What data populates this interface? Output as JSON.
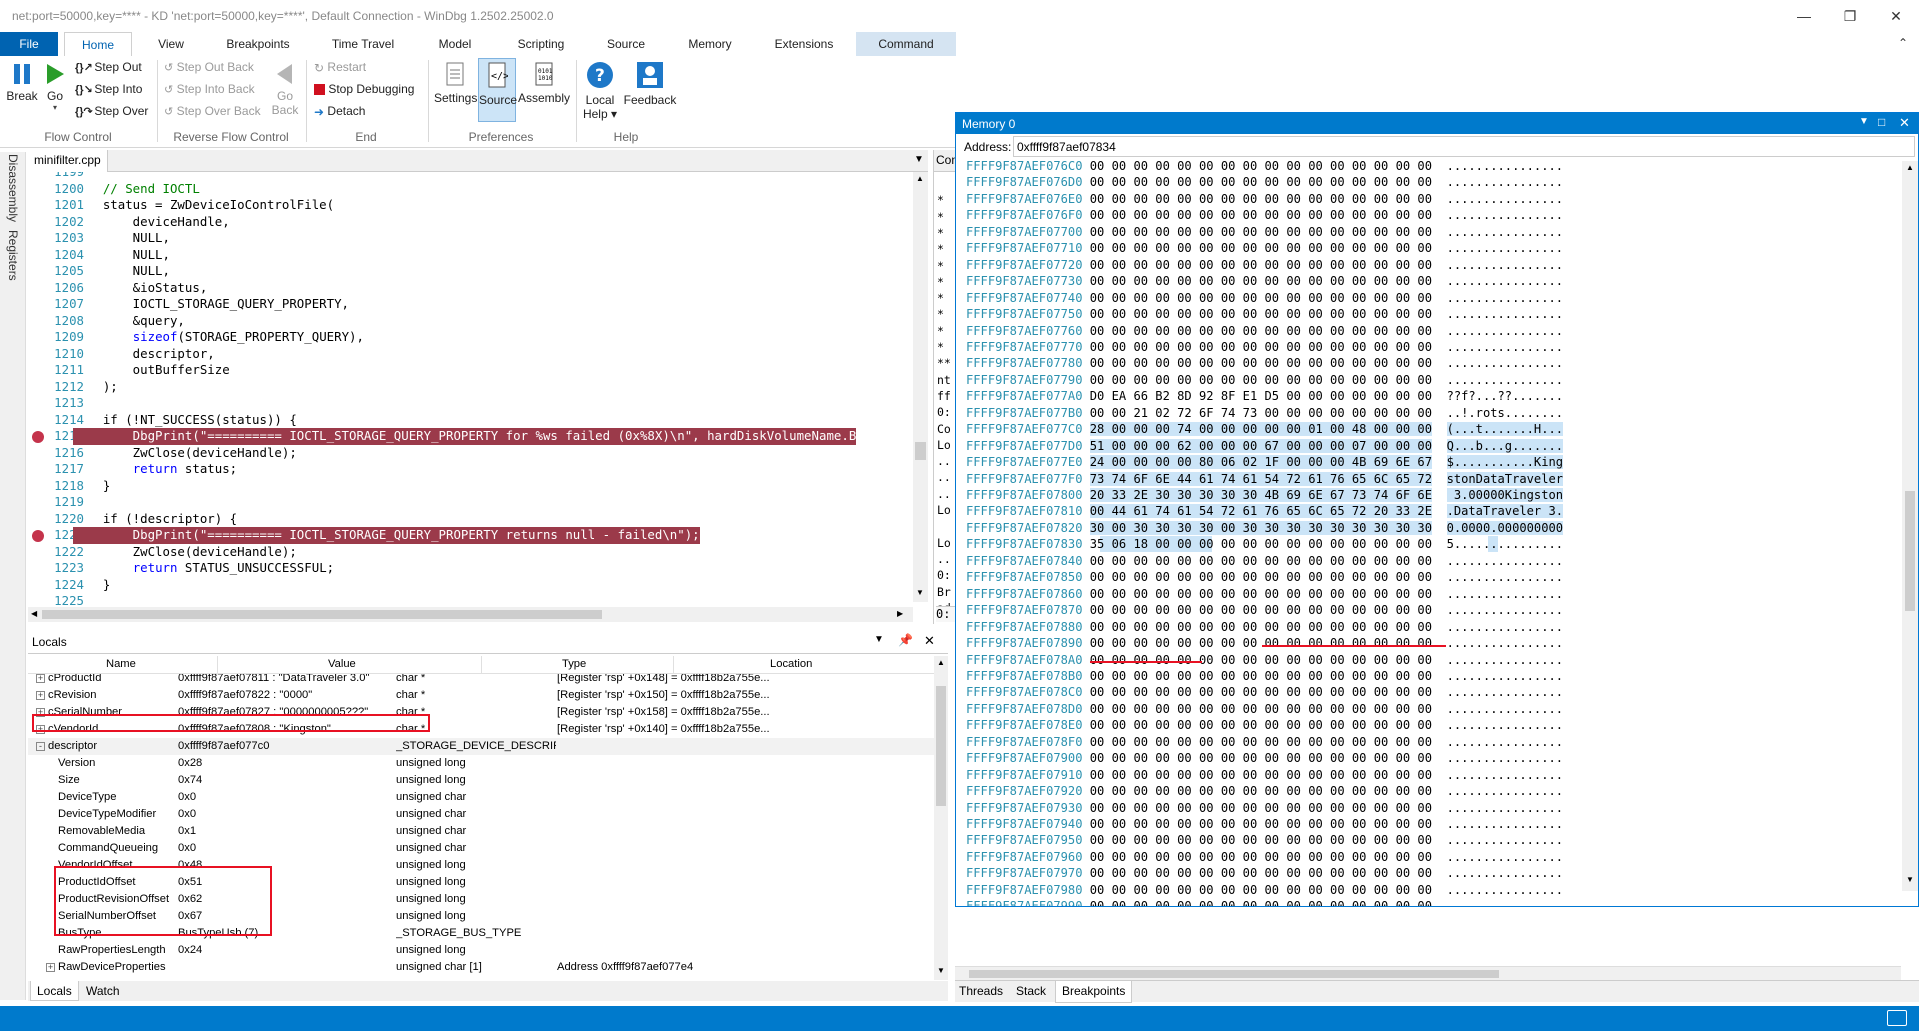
{
  "window": {
    "title": "net:port=50000,key=**** - KD 'net:port=50000,key=****', Default Connection  - WinDbg 1.2502.25002.0"
  },
  "menu_tabs": [
    "File",
    "Home",
    "View",
    "Breakpoints",
    "Time Travel",
    "Model",
    "Scripting",
    "Source",
    "Memory",
    "Extensions",
    "Command"
  ],
  "ribbon": {
    "break": "Break",
    "go": "Go",
    "step_out": "Step Out",
    "step_into": "Step Into",
    "step_over": "Step Over",
    "step_out_back": "Step Out Back",
    "step_into_back": "Step Into Back",
    "step_over_back": "Step Over Back",
    "go_back_1": "Go",
    "go_back_2": "Back",
    "restart": "Restart",
    "stop_debugging": "Stop Debugging",
    "detach": "Detach",
    "settings": "Settings",
    "source": "Source",
    "assembly": "Assembly",
    "local_help_1": "Local",
    "local_help_2": "Help ▾",
    "feedback": "Feedback",
    "groups": {
      "flow": "Flow Control",
      "reverse": "Reverse Flow Control",
      "end": "End",
      "prefs": "Preferences",
      "help": "Help"
    }
  },
  "side_tabs": {
    "disassembly": "Disassembly",
    "registers": "Registers"
  },
  "source": {
    "tab": "minifilter.cpp",
    "lines": [
      {
        "n": "1199",
        "code": "",
        "bp": false,
        "hl": false
      },
      {
        "n": "1200",
        "code": "    // Send IOCTL",
        "bp": false,
        "hl": false
      },
      {
        "n": "1201",
        "code": "    status = ZwDeviceIoControlFile(",
        "bp": false,
        "hl": false
      },
      {
        "n": "1202",
        "code": "        deviceHandle,",
        "bp": false,
        "hl": false
      },
      {
        "n": "1203",
        "code": "        NULL,",
        "bp": false,
        "hl": false
      },
      {
        "n": "1204",
        "code": "        NULL,",
        "bp": false,
        "hl": false
      },
      {
        "n": "1205",
        "code": "        NULL,",
        "bp": false,
        "hl": false
      },
      {
        "n": "1206",
        "code": "        &ioStatus,",
        "bp": false,
        "hl": false
      },
      {
        "n": "1207",
        "code": "        IOCTL_STORAGE_QUERY_PROPERTY,",
        "bp": false,
        "hl": false
      },
      {
        "n": "1208",
        "code": "        &query,",
        "bp": false,
        "hl": false
      },
      {
        "n": "1209",
        "code": "        sizeof(STORAGE_PROPERTY_QUERY),",
        "bp": false,
        "hl": false
      },
      {
        "n": "1210",
        "code": "        descriptor,",
        "bp": false,
        "hl": false
      },
      {
        "n": "1211",
        "code": "        outBufferSize",
        "bp": false,
        "hl": false
      },
      {
        "n": "1212",
        "code": "    );",
        "bp": false,
        "hl": false
      },
      {
        "n": "1213",
        "code": "",
        "bp": false,
        "hl": false
      },
      {
        "n": "1214",
        "code": "    if (!NT_SUCCESS(status)) {",
        "bp": false,
        "hl": false
      },
      {
        "n": "1215",
        "code": "        DbgPrint(\"========== IOCTL_STORAGE_QUERY_PROPERTY for %ws failed (0x%8X)\\n\", hardDiskVolumeName.B",
        "bp": true,
        "hl": true
      },
      {
        "n": "1216",
        "code": "        ZwClose(deviceHandle);",
        "bp": false,
        "hl": false
      },
      {
        "n": "1217",
        "code": "        return status;",
        "bp": false,
        "hl": false
      },
      {
        "n": "1218",
        "code": "    }",
        "bp": false,
        "hl": false
      },
      {
        "n": "1219",
        "code": "",
        "bp": false,
        "hl": false
      },
      {
        "n": "1220",
        "code": "    if (!descriptor) {",
        "bp": false,
        "hl": false
      },
      {
        "n": "1221",
        "code": "        DbgPrint(\"========== IOCTL_STORAGE_QUERY_PROPERTY returns null - failed\\n\");",
        "bp": true,
        "hl": true
      },
      {
        "n": "1222",
        "code": "        ZwClose(deviceHandle);",
        "bp": false,
        "hl": false
      },
      {
        "n": "1223",
        "code": "        return STATUS_UNSUCCESSFUL;",
        "bp": false,
        "hl": false
      },
      {
        "n": "1224",
        "code": "    }",
        "bp": false,
        "hl": false
      },
      {
        "n": "1225",
        "code": "",
        "bp": false,
        "hl": false
      }
    ]
  },
  "command_panel": {
    "tab": "Con",
    "lines": [
      "",
      "*",
      "*",
      "*",
      "*",
      "*",
      "*",
      "*",
      "*",
      "*",
      "*",
      "**",
      "nt",
      "ff",
      "0:",
      "Co",
      "Lo",
      "..",
      "..",
      "..",
      "Lo",
      "",
      "Lo",
      "..",
      "0:",
      "Br",
      "ad"
    ],
    "prompt": "0:"
  },
  "locals": {
    "title": "Locals",
    "columns": {
      "name": "Name",
      "value": "Value",
      "type": "Type",
      "location": "Location"
    },
    "rows": [
      {
        "expander": "+",
        "indent": 0,
        "name": "cProductId",
        "value": "0xffff9f87aef07811 : \"DataTraveler 3.0\"",
        "type": "char *",
        "location": "[Register 'rsp' +0x148] = 0xffff18b2a755e..."
      },
      {
        "expander": "+",
        "indent": 0,
        "name": "cRevision",
        "value": "0xffff9f87aef07822 : \"0000\"",
        "type": "char *",
        "location": "[Register 'rsp' +0x150] = 0xffff18b2a755e..."
      },
      {
        "expander": "+",
        "indent": 0,
        "name": "cSerialNumber",
        "value": "0xffff9f87aef07827 : \"0000000005???\"",
        "type": "char *",
        "location": "[Register 'rsp' +0x158] = 0xffff18b2a755e..."
      },
      {
        "expander": "+",
        "indent": 0,
        "name": "cVendorId",
        "value": "0xffff9f87aef07808 : \"Kingston\"",
        "type": "char *",
        "location": "[Register 'rsp' +0x140] = 0xffff18b2a755e..."
      },
      {
        "expander": "-",
        "indent": 0,
        "name": "descriptor",
        "value": "0xffff9f87aef077c0",
        "type": "_STORAGE_DEVICE_DESCRIPTOR *",
        "location": ""
      },
      {
        "expander": "",
        "indent": 1,
        "name": "Version",
        "value": "0x28",
        "type": "unsigned long",
        "location": ""
      },
      {
        "expander": "",
        "indent": 1,
        "name": "Size",
        "value": "0x74",
        "type": "unsigned long",
        "location": ""
      },
      {
        "expander": "",
        "indent": 1,
        "name": "DeviceType",
        "value": "0x0",
        "type": "unsigned char",
        "location": ""
      },
      {
        "expander": "",
        "indent": 1,
        "name": "DeviceTypeModifier",
        "value": "0x0",
        "type": "unsigned char",
        "location": ""
      },
      {
        "expander": "",
        "indent": 1,
        "name": "RemovableMedia",
        "value": "0x1",
        "type": "unsigned char",
        "location": ""
      },
      {
        "expander": "",
        "indent": 1,
        "name": "CommandQueueing",
        "value": "0x0",
        "type": "unsigned char",
        "location": ""
      },
      {
        "expander": "",
        "indent": 1,
        "name": "VendorIdOffset",
        "value": "0x48",
        "type": "unsigned long",
        "location": ""
      },
      {
        "expander": "",
        "indent": 1,
        "name": "ProductIdOffset",
        "value": "0x51",
        "type": "unsigned long",
        "location": ""
      },
      {
        "expander": "",
        "indent": 1,
        "name": "ProductRevisionOffset",
        "value": "0x62",
        "type": "unsigned long",
        "location": ""
      },
      {
        "expander": "",
        "indent": 1,
        "name": "SerialNumberOffset",
        "value": "0x67",
        "type": "unsigned long",
        "location": ""
      },
      {
        "expander": "",
        "indent": 1,
        "name": "BusType",
        "value": "BusTypeUsb (7)",
        "type": "_STORAGE_BUS_TYPE",
        "location": ""
      },
      {
        "expander": "",
        "indent": 1,
        "name": "RawPropertiesLength",
        "value": "0x24",
        "type": "unsigned long",
        "location": ""
      },
      {
        "expander": "+",
        "indent": 1,
        "name": "RawDeviceProperties",
        "value": "",
        "type": "unsigned char [1]",
        "location": "Address 0xffff9f87aef077e4"
      }
    ],
    "bottom_tabs": [
      "Locals",
      "Watch"
    ]
  },
  "memory": {
    "title": "Memory 0",
    "address_label": "Address:",
    "address_value": "0xffff9f87aef07834",
    "rows": [
      {
        "addr": "FFFF9F87AEF076C0",
        "bytes": "00 00 00 00 00 00 00 00 00 00 00 00 00 00 00 00",
        "ascii": "................"
      },
      {
        "addr": "FFFF9F87AEF076D0",
        "bytes": "00 00 00 00 00 00 00 00 00 00 00 00 00 00 00 00",
        "ascii": "................"
      },
      {
        "addr": "FFFF9F87AEF076E0",
        "bytes": "00 00 00 00 00 00 00 00 00 00 00 00 00 00 00 00",
        "ascii": "................"
      },
      {
        "addr": "FFFF9F87AEF076F0",
        "bytes": "00 00 00 00 00 00 00 00 00 00 00 00 00 00 00 00",
        "ascii": "................"
      },
      {
        "addr": "FFFF9F87AEF07700",
        "bytes": "00 00 00 00 00 00 00 00 00 00 00 00 00 00 00 00",
        "ascii": "................"
      },
      {
        "addr": "FFFF9F87AEF07710",
        "bytes": "00 00 00 00 00 00 00 00 00 00 00 00 00 00 00 00",
        "ascii": "................"
      },
      {
        "addr": "FFFF9F87AEF07720",
        "bytes": "00 00 00 00 00 00 00 00 00 00 00 00 00 00 00 00",
        "ascii": "................"
      },
      {
        "addr": "FFFF9F87AEF07730",
        "bytes": "00 00 00 00 00 00 00 00 00 00 00 00 00 00 00 00",
        "ascii": "................"
      },
      {
        "addr": "FFFF9F87AEF07740",
        "bytes": "00 00 00 00 00 00 00 00 00 00 00 00 00 00 00 00",
        "ascii": "................"
      },
      {
        "addr": "FFFF9F87AEF07750",
        "bytes": "00 00 00 00 00 00 00 00 00 00 00 00 00 00 00 00",
        "ascii": "................"
      },
      {
        "addr": "FFFF9F87AEF07760",
        "bytes": "00 00 00 00 00 00 00 00 00 00 00 00 00 00 00 00",
        "ascii": "................"
      },
      {
        "addr": "FFFF9F87AEF07770",
        "bytes": "00 00 00 00 00 00 00 00 00 00 00 00 00 00 00 00",
        "ascii": "................"
      },
      {
        "addr": "FFFF9F87AEF07780",
        "bytes": "00 00 00 00 00 00 00 00 00 00 00 00 00 00 00 00",
        "ascii": "................"
      },
      {
        "addr": "FFFF9F87AEF07790",
        "bytes": "00 00 00 00 00 00 00 00 00 00 00 00 00 00 00 00",
        "ascii": "................"
      },
      {
        "addr": "FFFF9F87AEF077A0",
        "bytes": "D0 EA 66 B2 8D 92 8F E1 D5 00 00 00 00 00 00 00",
        "ascii": "??f?...??......."
      },
      {
        "addr": "FFFF9F87AEF077B0",
        "bytes": "00 00 21 02 72 6F 74 73 00 00 00 00 00 00 00 00",
        "ascii": "..!.rots........"
      },
      {
        "addr": "FFFF9F87AEF077C0",
        "bytes": "28 00 00 00 74 00 00 00 00 00 01 00 48 00 00 00",
        "ascii": "(...t.......H...",
        "sel": true
      },
      {
        "addr": "FFFF9F87AEF077D0",
        "bytes": "51 00 00 00 62 00 00 00 67 00 00 00 07 00 00 00",
        "ascii": "Q...b...g.......",
        "sel": true
      },
      {
        "addr": "FFFF9F87AEF077E0",
        "bytes": "24 00 00 00 00 80 06 02 1F 00 00 00 4B 69 6E 67",
        "ascii": "$...........King",
        "sel": true
      },
      {
        "addr": "FFFF9F87AEF077F0",
        "bytes": "73 74 6F 6E 44 61 74 61 54 72 61 76 65 6C 65 72",
        "ascii": "stonDataTraveler",
        "sel": true
      },
      {
        "addr": "FFFF9F87AEF07800",
        "bytes": "20 33 2E 30 30 30 30 30 4B 69 6E 67 73 74 6F 6E",
        "ascii": " 3.00000Kingston",
        "sel": true
      },
      {
        "addr": "FFFF9F87AEF07810",
        "bytes": "00 44 61 74 61 54 72 61 76 65 6C 65 72 20 33 2E",
        "ascii": ".DataTraveler 3.",
        "sel": true
      },
      {
        "addr": "FFFF9F87AEF07820",
        "bytes": "30 00 30 30 30 30 00 30 30 30 30 30 30 30 30 30",
        "ascii": "0.0000.000000000",
        "sel": true
      },
      {
        "addr": "FFFF9F87AEF07830",
        "bytes": "35 06 18 00 00 00 00 00 00 00 00 00 00 00 00 00",
        "ascii": "5...............",
        "sel": "partial"
      },
      {
        "addr": "FFFF9F87AEF07840",
        "bytes": "00 00 00 00 00 00 00 00 00 00 00 00 00 00 00 00",
        "ascii": "................"
      },
      {
        "addr": "FFFF9F87AEF07850",
        "bytes": "00 00 00 00 00 00 00 00 00 00 00 00 00 00 00 00",
        "ascii": "................"
      },
      {
        "addr": "FFFF9F87AEF07860",
        "bytes": "00 00 00 00 00 00 00 00 00 00 00 00 00 00 00 00",
        "ascii": "................"
      },
      {
        "addr": "FFFF9F87AEF07870",
        "bytes": "00 00 00 00 00 00 00 00 00 00 00 00 00 00 00 00",
        "ascii": "................"
      },
      {
        "addr": "FFFF9F87AEF07880",
        "bytes": "00 00 00 00 00 00 00 00 00 00 00 00 00 00 00 00",
        "ascii": "................"
      },
      {
        "addr": "FFFF9F87AEF07890",
        "bytes": "00 00 00 00 00 00 00 00 00 00 00 00 00 00 00 00",
        "ascii": "................"
      },
      {
        "addr": "FFFF9F87AEF078A0",
        "bytes": "00 00 00 00 00 00 00 00 00 00 00 00 00 00 00 00",
        "ascii": "................"
      },
      {
        "addr": "FFFF9F87AEF078B0",
        "bytes": "00 00 00 00 00 00 00 00 00 00 00 00 00 00 00 00",
        "ascii": "................"
      },
      {
        "addr": "FFFF9F87AEF078C0",
        "bytes": "00 00 00 00 00 00 00 00 00 00 00 00 00 00 00 00",
        "ascii": "................"
      },
      {
        "addr": "FFFF9F87AEF078D0",
        "bytes": "00 00 00 00 00 00 00 00 00 00 00 00 00 00 00 00",
        "ascii": "................"
      },
      {
        "addr": "FFFF9F87AEF078E0",
        "bytes": "00 00 00 00 00 00 00 00 00 00 00 00 00 00 00 00",
        "ascii": "................"
      },
      {
        "addr": "FFFF9F87AEF078F0",
        "bytes": "00 00 00 00 00 00 00 00 00 00 00 00 00 00 00 00",
        "ascii": "................"
      },
      {
        "addr": "FFFF9F87AEF07900",
        "bytes": "00 00 00 00 00 00 00 00 00 00 00 00 00 00 00 00",
        "ascii": "................"
      },
      {
        "addr": "FFFF9F87AEF07910",
        "bytes": "00 00 00 00 00 00 00 00 00 00 00 00 00 00 00 00",
        "ascii": "................"
      },
      {
        "addr": "FFFF9F87AEF07920",
        "bytes": "00 00 00 00 00 00 00 00 00 00 00 00 00 00 00 00",
        "ascii": "................"
      },
      {
        "addr": "FFFF9F87AEF07930",
        "bytes": "00 00 00 00 00 00 00 00 00 00 00 00 00 00 00 00",
        "ascii": "................"
      },
      {
        "addr": "FFFF9F87AEF07940",
        "bytes": "00 00 00 00 00 00 00 00 00 00 00 00 00 00 00 00",
        "ascii": "................"
      },
      {
        "addr": "FFFF9F87AEF07950",
        "bytes": "00 00 00 00 00 00 00 00 00 00 00 00 00 00 00 00",
        "ascii": "................"
      },
      {
        "addr": "FFFF9F87AEF07960",
        "bytes": "00 00 00 00 00 00 00 00 00 00 00 00 00 00 00 00",
        "ascii": "................"
      },
      {
        "addr": "FFFF9F87AEF07970",
        "bytes": "00 00 00 00 00 00 00 00 00 00 00 00 00 00 00 00",
        "ascii": "................"
      },
      {
        "addr": "FFFF9F87AEF07980",
        "bytes": "00 00 00 00 00 00 00 00 00 00 00 00 00 00 00 00",
        "ascii": "................"
      },
      {
        "addr": "FFFF9F87AEF07990",
        "bytes": "00 00 00 00 00 00 00 00 00 00 00 00 00 00 00 00",
        "ascii": "................"
      }
    ],
    "bottom_tabs": [
      "Threads",
      "Stack",
      "Breakpoints"
    ]
  },
  "colors": {
    "accent": "#007acc",
    "file_tab": "#0063b1",
    "breakpoint": "#c4334b",
    "annotation": "#e81123"
  }
}
